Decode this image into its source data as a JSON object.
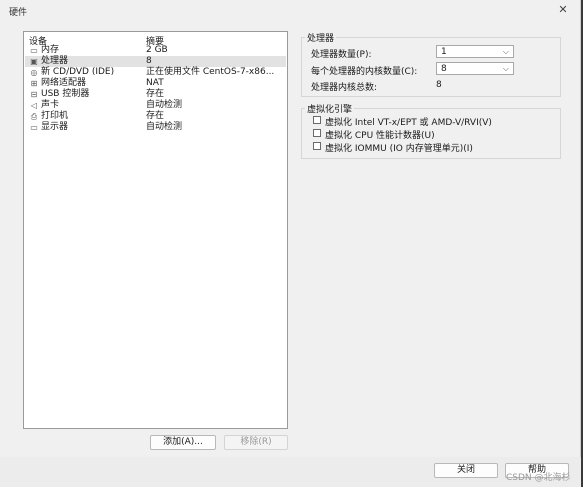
{
  "window": {
    "title": "硬件",
    "close_glyph": "✕"
  },
  "device_list": {
    "col_device": "设备",
    "col_summary": "摘要",
    "items": [
      {
        "name": "内存",
        "summary": "2 GB",
        "icon": "memory-icon",
        "selected": false
      },
      {
        "name": "处理器",
        "summary": "8",
        "icon": "cpu-icon",
        "selected": true
      },
      {
        "name": "新 CD/DVD (IDE)",
        "summary": "正在使用文件 CentOS-7-x86...",
        "icon": "cd-dvd-icon",
        "selected": false
      },
      {
        "name": "网络适配器",
        "summary": "NAT",
        "icon": "network-adapter-icon",
        "selected": false
      },
      {
        "name": "USB 控制器",
        "summary": "存在",
        "icon": "usb-icon",
        "selected": false
      },
      {
        "name": "声卡",
        "summary": "自动检测",
        "icon": "speaker-icon",
        "selected": false
      },
      {
        "name": "打印机",
        "summary": "存在",
        "icon": "printer-icon",
        "selected": false
      },
      {
        "name": "显示器",
        "summary": "自动检测",
        "icon": "monitor-icon",
        "selected": false
      }
    ],
    "add_label": "添加(A)...",
    "remove_label": "移除(R)"
  },
  "processor": {
    "group_title": "处理器",
    "count_label": "处理器数量(P):",
    "count_value": "1",
    "cores_label": "每个处理器的内核数量(C):",
    "cores_value": "8",
    "total_label": "处理器内核总数:",
    "total_value": "8"
  },
  "virtualization": {
    "group_title": "虚拟化引擎",
    "options": [
      {
        "label": "虚拟化 Intel VT-x/EPT 或 AMD-V/RVI(V)",
        "checked": false
      },
      {
        "label": "虚拟化 CPU 性能计数器(U)",
        "checked": false
      },
      {
        "label": "虚拟化 IOMMU (IO 内存管理单元)(I)",
        "checked": false
      }
    ]
  },
  "footer": {
    "close_label": "关闭",
    "help_label": "帮助"
  },
  "watermark": "CSDN @北海杉"
}
